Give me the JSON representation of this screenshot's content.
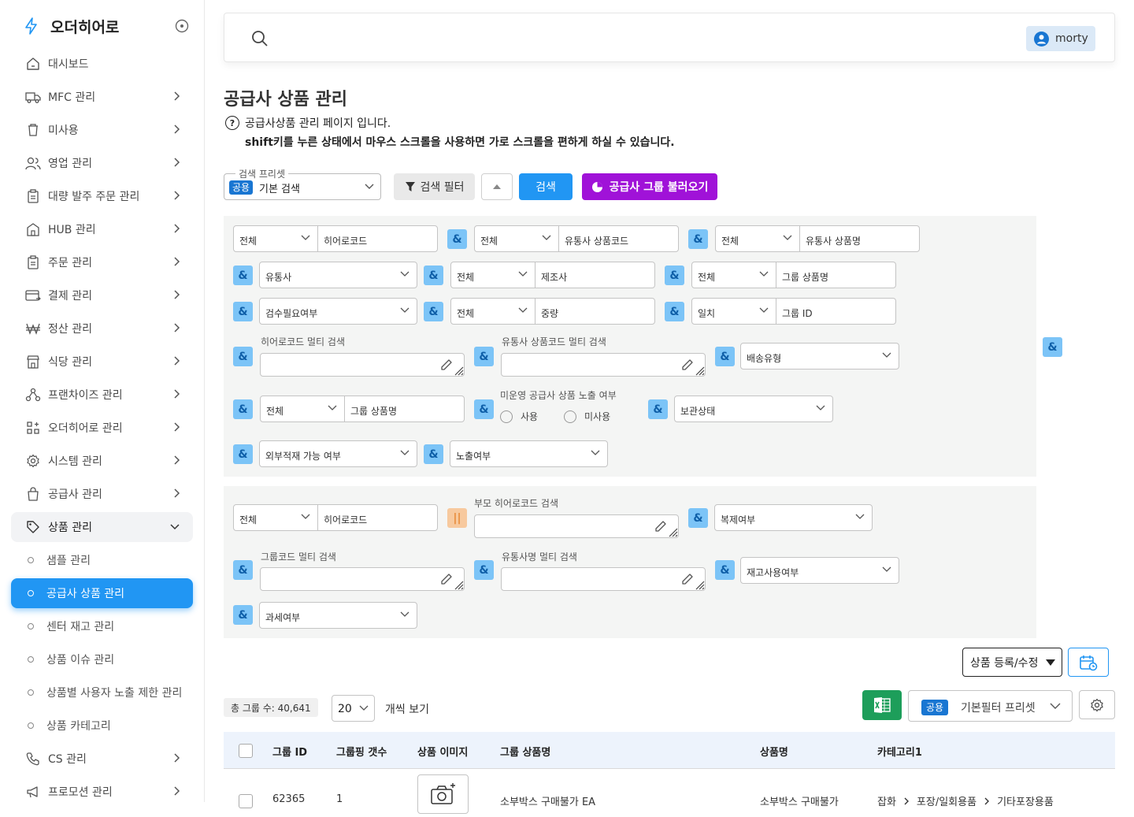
{
  "app": {
    "brand": "오더히어로"
  },
  "sidebar": {
    "items": [
      {
        "label": "대시보드",
        "icon": "home-icon"
      },
      {
        "label": "MFC 관리",
        "icon": "truck-icon"
      },
      {
        "label": "미사용",
        "icon": "trash-icon"
      },
      {
        "label": "영업 관리",
        "icon": "users-icon"
      },
      {
        "label": "대량 발주 주문 관리",
        "icon": "clipboard-icon"
      },
      {
        "label": "HUB 관리",
        "icon": "building-icon"
      },
      {
        "label": "주문 관리",
        "icon": "clipboard-icon"
      },
      {
        "label": "결제 관리",
        "icon": "card-icon"
      },
      {
        "label": "정산 관리",
        "icon": "won-icon"
      },
      {
        "label": "식당 관리",
        "icon": "store-icon"
      },
      {
        "label": "프랜차이즈 관리",
        "icon": "network-icon"
      },
      {
        "label": "오더히어로 관리",
        "icon": "grid-plus-icon"
      },
      {
        "label": "시스템 관리",
        "icon": "gear-icon"
      },
      {
        "label": "공급사 관리",
        "icon": "bag-icon"
      },
      {
        "label": "상품 관리",
        "icon": "tag-icon"
      }
    ],
    "sub_items": [
      {
        "label": "샘플 관리"
      },
      {
        "label": "공급사 상품 관리"
      },
      {
        "label": "센터 재고 관리"
      },
      {
        "label": "상품 이슈 관리"
      },
      {
        "label": "상품별 사용자 노출 제한 관리"
      },
      {
        "label": "상품 카테고리"
      }
    ],
    "after_items": [
      {
        "label": "CS 관리",
        "icon": "phone-icon"
      },
      {
        "label": "프로모션 관리",
        "icon": "megaphone-icon"
      }
    ]
  },
  "topbar": {
    "user": "morty"
  },
  "page": {
    "title": "공급사 상품 관리",
    "desc1": "공급사상품 관리 페이지 입니다.",
    "desc2": "shift키를 누른 상태에서 마우스 스크롤을 사용하면 가로 스크롤을 편하게 하실 수 있습니다."
  },
  "toolbar": {
    "preset_legend": "검색 프리셋",
    "preset_tag": "공용",
    "preset_value": "기본 검색",
    "filter_label": "검색 필터",
    "search_label": "검색",
    "group_label": "공급사 그룹 불러오기"
  },
  "filters": {
    "all": "전체",
    "amp": "&",
    "hero_code": "히어로코드",
    "dist_code": "유통사 상품코드",
    "dist_name": "유통사 상품명",
    "distributor": "유통사",
    "maker": "제조사",
    "group_name": "그룹 상품명",
    "inspect": "검수필요여부",
    "weight": "중량",
    "match": "일치",
    "group_id": "그룹 ID",
    "hero_multi": "히어로코드 멀티 검색",
    "dist_code_multi": "유통사 상품코드 멀티 검색",
    "delivery": "배송유형",
    "unopened_label": "미운영 공급사 상품 노출 여부",
    "use": "사용",
    "unuse": "미사용",
    "storage": "보관상태",
    "outer": "외부적재 가능 여부",
    "exposure": "노출여부",
    "or": "||",
    "parent_multi": "부모 히어로코드 검색",
    "copy": "복제여부",
    "group_code_multi": "그룹코드 멀티 검색",
    "dist_name_multi": "유통사명 멀티 검색",
    "reuse": "재고사용여부",
    "tax": "과세여부"
  },
  "list": {
    "register_label": "상품 등록/수정",
    "total": "총 그룹 수: 40,641",
    "per_page": "20",
    "per_page_suffix": "개씩 보기",
    "filter_preset_tag": "공용",
    "filter_preset": "기본필터 프리셋",
    "columns": [
      "그룹 ID",
      "그룹핑 갯수",
      "상품 이미지",
      "그룹 상품명",
      "상품명",
      "카테고리1"
    ],
    "rows": [
      {
        "id": "62365",
        "count": "1",
        "group_name": "소부박스 구매불가 EA",
        "name": "소부박스 구매불가",
        "cat": [
          "잡화",
          "포장/일회용품",
          "기타포장용품"
        ]
      }
    ]
  },
  "colors": {
    "primary": "#2196f3",
    "purple": "#a012d8",
    "excel": "#1d9e5a",
    "amp": "#7cc4f7"
  }
}
